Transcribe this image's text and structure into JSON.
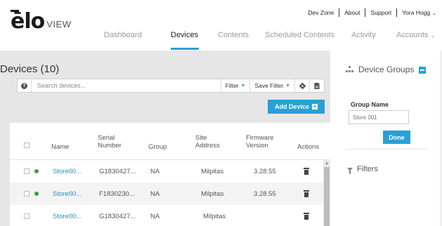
{
  "brand": {
    "logo_main": "ēlo",
    "logo_sub": "VIEW"
  },
  "topnav": {
    "dev_zone": "Dev Zone",
    "about": "About",
    "support": "Support",
    "user": "Yora Hogg"
  },
  "mainnav": [
    {
      "label": "Dashboard"
    },
    {
      "label": "Devices"
    },
    {
      "label": "Contents"
    },
    {
      "label": "Scheduled Contents"
    },
    {
      "label": "Activity"
    },
    {
      "label": "Accounts"
    }
  ],
  "active_tab": "Devices",
  "devices": {
    "title": "Devices (10)",
    "search_placeholder": "Search devices...",
    "filter_label": "Filter",
    "save_filter_label": "Save Filter",
    "add_device_label": "Add Device"
  },
  "table": {
    "headers": {
      "name": "Name",
      "serial_1": "Serial",
      "serial_2": "Number",
      "group": "Group",
      "site_1": "Site",
      "site_2": "Address",
      "fw_1": "Firmware",
      "fw_2": "Version",
      "actions": "Actions"
    },
    "rows": [
      {
        "name": "Store00...",
        "serial": "G1830427...",
        "group": "NA",
        "site": "Milpitas",
        "firmware": "3.28.55",
        "online": true
      },
      {
        "name": "Store00...",
        "serial": "F1830230...",
        "group": "NA",
        "site": "Milpitas",
        "firmware": "3.28.55",
        "online": true
      },
      {
        "name": "Store00...",
        "serial": "G1830427...",
        "group": "NA",
        "site": "Milpitas",
        "firmware": "",
        "online": false
      }
    ]
  },
  "side": {
    "device_groups": "Device Groups",
    "group_name_label": "Group Name",
    "group_name_value": "Store 001",
    "done_label": "Done",
    "filters_label": "Filters"
  },
  "colors": {
    "accent": "#2aa0d6",
    "online": "#3aa03a",
    "panel_bg": "#e6e6e6"
  }
}
